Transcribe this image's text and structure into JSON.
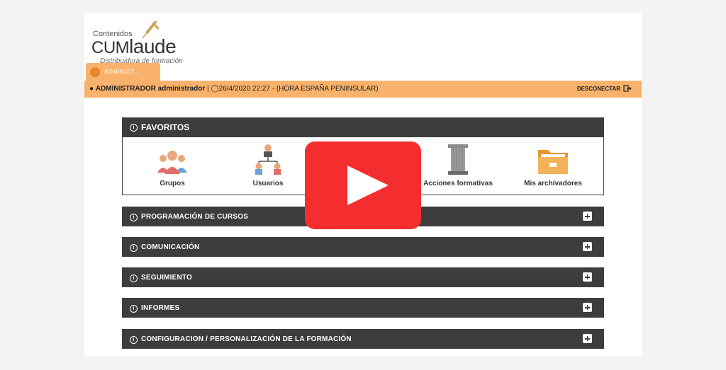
{
  "logo": {
    "top": "Contenidos",
    "brand_a": "CUM",
    "brand_b": "laude",
    "subtitle": "Distribuidora de formación"
  },
  "tab": {
    "label": "ADMINIST..."
  },
  "bar": {
    "user": "ADMINISTRADOR administrador",
    "datetime": "26/4/2020 22:27 - (HORA ESPAÑA PENINSULAR)",
    "logout": "DESCONECTAR"
  },
  "favorites": {
    "title": "FAVORITOS",
    "items": [
      {
        "label": "Grupos",
        "icon": "group-people-icon"
      },
      {
        "label": "Usuarios",
        "icon": "users-icon"
      },
      {
        "label": "Acciones formativas",
        "icon": "column-pillar-icon"
      },
      {
        "label": "Mis archivadores",
        "icon": "folder-icon"
      }
    ]
  },
  "sections": [
    "PROGRAMACIÓN DE CURSOS",
    "COMUNICACIÓN",
    "SEGUIMIENTO",
    "INFORMES",
    "CONFIGURACION / PERSONALIZACIÓN DE LA FORMACIÓN"
  ],
  "colors": {
    "accent": "#f8b26b",
    "dark": "#3d3d3d",
    "play": "#f42e2e"
  }
}
